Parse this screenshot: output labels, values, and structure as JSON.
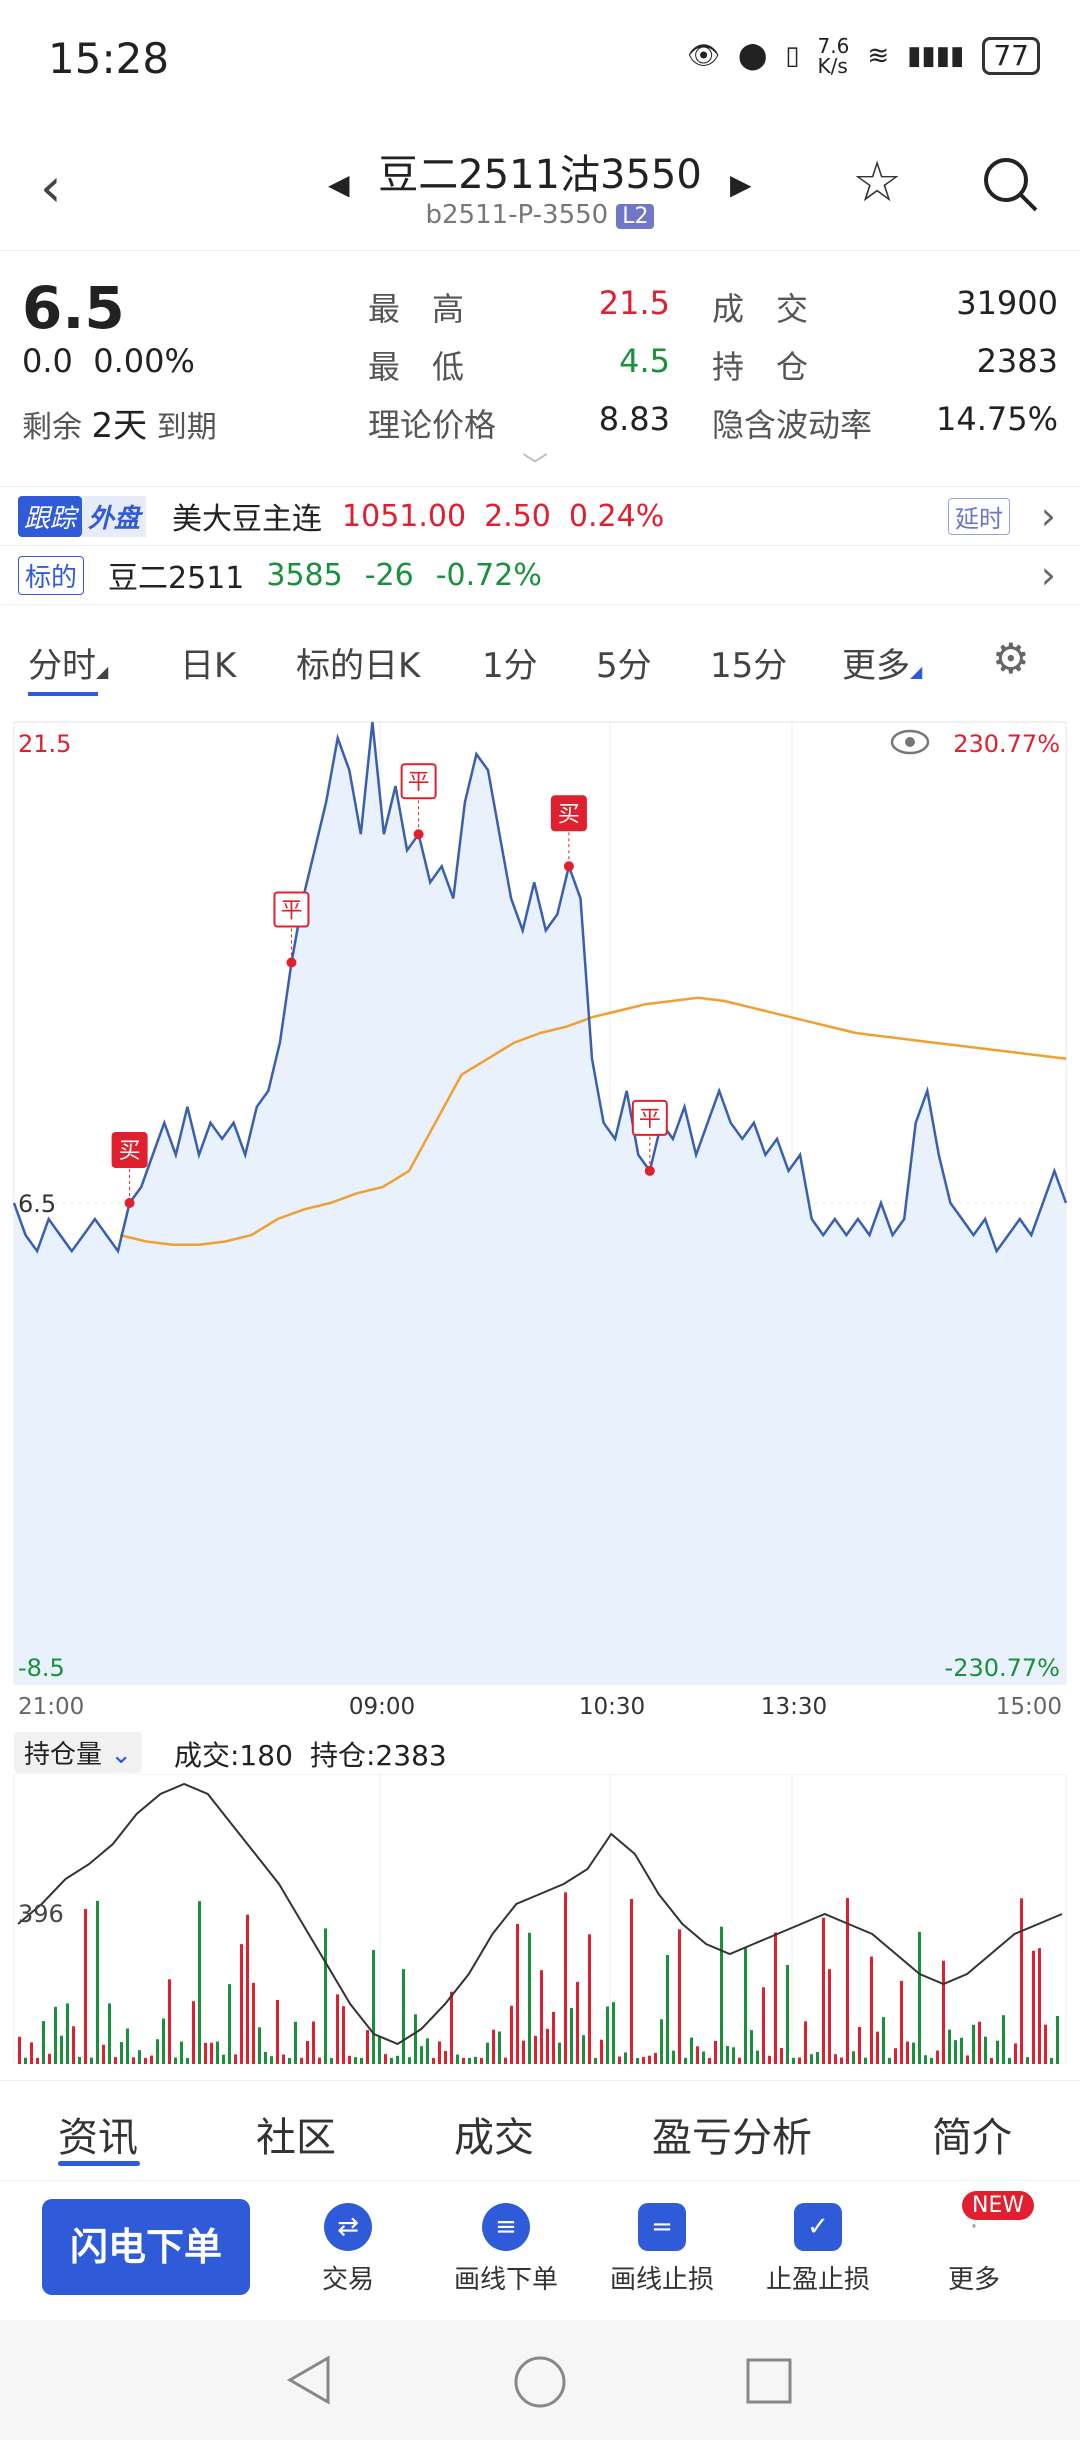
{
  "status_bar": {
    "time": "15:28",
    "speed": "7.6\nK/s",
    "battery": "77"
  },
  "header": {
    "title": "豆二2511沽3550",
    "code": "b2511-P-3550",
    "badge": "L2"
  },
  "quote": {
    "last": "6.5",
    "change": "0.0",
    "change_pct": "0.00%",
    "remain_label": "剩余",
    "remain_days": "2天",
    "expire_label": "到期",
    "high_label": "最　高",
    "high": "21.5",
    "low_label": "最　低",
    "low": "4.5",
    "theory_label": "理论价格",
    "theory": "8.83",
    "volume_label": "成　交",
    "volume": "31900",
    "oi_label": "持　仓",
    "oi": "2383",
    "iv_label": "隐含波动率",
    "iv": "14.75%"
  },
  "outer_bar": {
    "tag_a": "跟踪",
    "tag_b": "外盘",
    "name": "美大豆主连",
    "price": "1051.00",
    "chg": "2.50",
    "chg_pct": "0.24%",
    "delay": "延时"
  },
  "underlying_bar": {
    "tag": "标的",
    "name": "豆二2511",
    "price": "3585",
    "chg": "-26",
    "chg_pct": "-0.72%"
  },
  "chart_tabs": [
    "分时",
    "日K",
    "标的日K",
    "1分",
    "5分",
    "15分",
    "更多"
  ],
  "chart_labels": {
    "ymax": "21.5",
    "ymid": "6.5",
    "ymin": "-8.5",
    "pct_max": "230.77%",
    "pct_min": "-230.77%",
    "t0": "21:00",
    "t1": "09:00",
    "t2": "10:30",
    "t3": "13:30",
    "t4": "15:00"
  },
  "markers": {
    "buy": "买",
    "close": "平"
  },
  "volume_panel": {
    "selector": "持仓量",
    "volume": "成交:180",
    "oi": "持仓:2383",
    "axis": "396"
  },
  "bottom_tabs": [
    "资讯",
    "社区",
    "成交",
    "盈亏分析",
    "简介"
  ],
  "actions": {
    "flash": "闪电下单",
    "trade": "交易",
    "draw_order": "画线下单",
    "draw_stop": "画线止损",
    "tp_sl": "止盈止损",
    "more": "更多",
    "new_badge": "NEW"
  },
  "colors": {
    "accent": "#2f5bd8",
    "up": "#e0202e",
    "down": "#18913a",
    "avg_line": "#f0a030"
  },
  "chart_data": {
    "type": "line",
    "ylim": [
      -8.5,
      21.5
    ],
    "series": [
      {
        "values": [
          6.5,
          5.5,
          5.0,
          6.0,
          5.5,
          5.0,
          5.5,
          6.0,
          5.5,
          5.0,
          6.5,
          7.0,
          8.0,
          9.0,
          8.0,
          9.5,
          8.0,
          9.0,
          8.5,
          9.0,
          8.0,
          9.5,
          10.0,
          11.5,
          14.0,
          16.0,
          17.5,
          19.0,
          21.0,
          20.0,
          18.0,
          21.5,
          18.0,
          19.5,
          17.5,
          18.0,
          16.5,
          17.0,
          16.0,
          19.0,
          20.5,
          20.0,
          18.0,
          16.0,
          15.0,
          16.5,
          15.0,
          15.5,
          17.0,
          16.0,
          11.0,
          9.0,
          8.5,
          10.0,
          8.0,
          7.5,
          9.0,
          8.5,
          9.5,
          8.0,
          9.0,
          10.0,
          9.0,
          8.5,
          9.0,
          8.0,
          8.5,
          7.5,
          8.0,
          6.0,
          5.5,
          6.0,
          5.5,
          6.0,
          5.5,
          6.5,
          5.5,
          6.0,
          9.0,
          10.0,
          8.0,
          6.5,
          6.0,
          5.5,
          6.0,
          5.0,
          5.5,
          6.0,
          5.5,
          6.5,
          7.5,
          6.5
        ]
      },
      {
        "values": [
          5.5,
          5.3,
          5.2,
          5.2,
          5.3,
          5.5,
          6.0,
          6.3,
          6.5,
          6.8,
          7.0,
          7.5,
          9.0,
          10.5,
          11.0,
          11.5,
          11.8,
          12.0,
          12.3,
          12.5,
          12.7,
          12.8,
          12.9,
          12.8,
          12.6,
          12.4,
          12.2,
          12.0,
          11.8,
          11.7,
          11.6,
          11.5,
          11.4,
          11.3,
          11.2,
          11.1,
          11.0
        ]
      }
    ]
  }
}
